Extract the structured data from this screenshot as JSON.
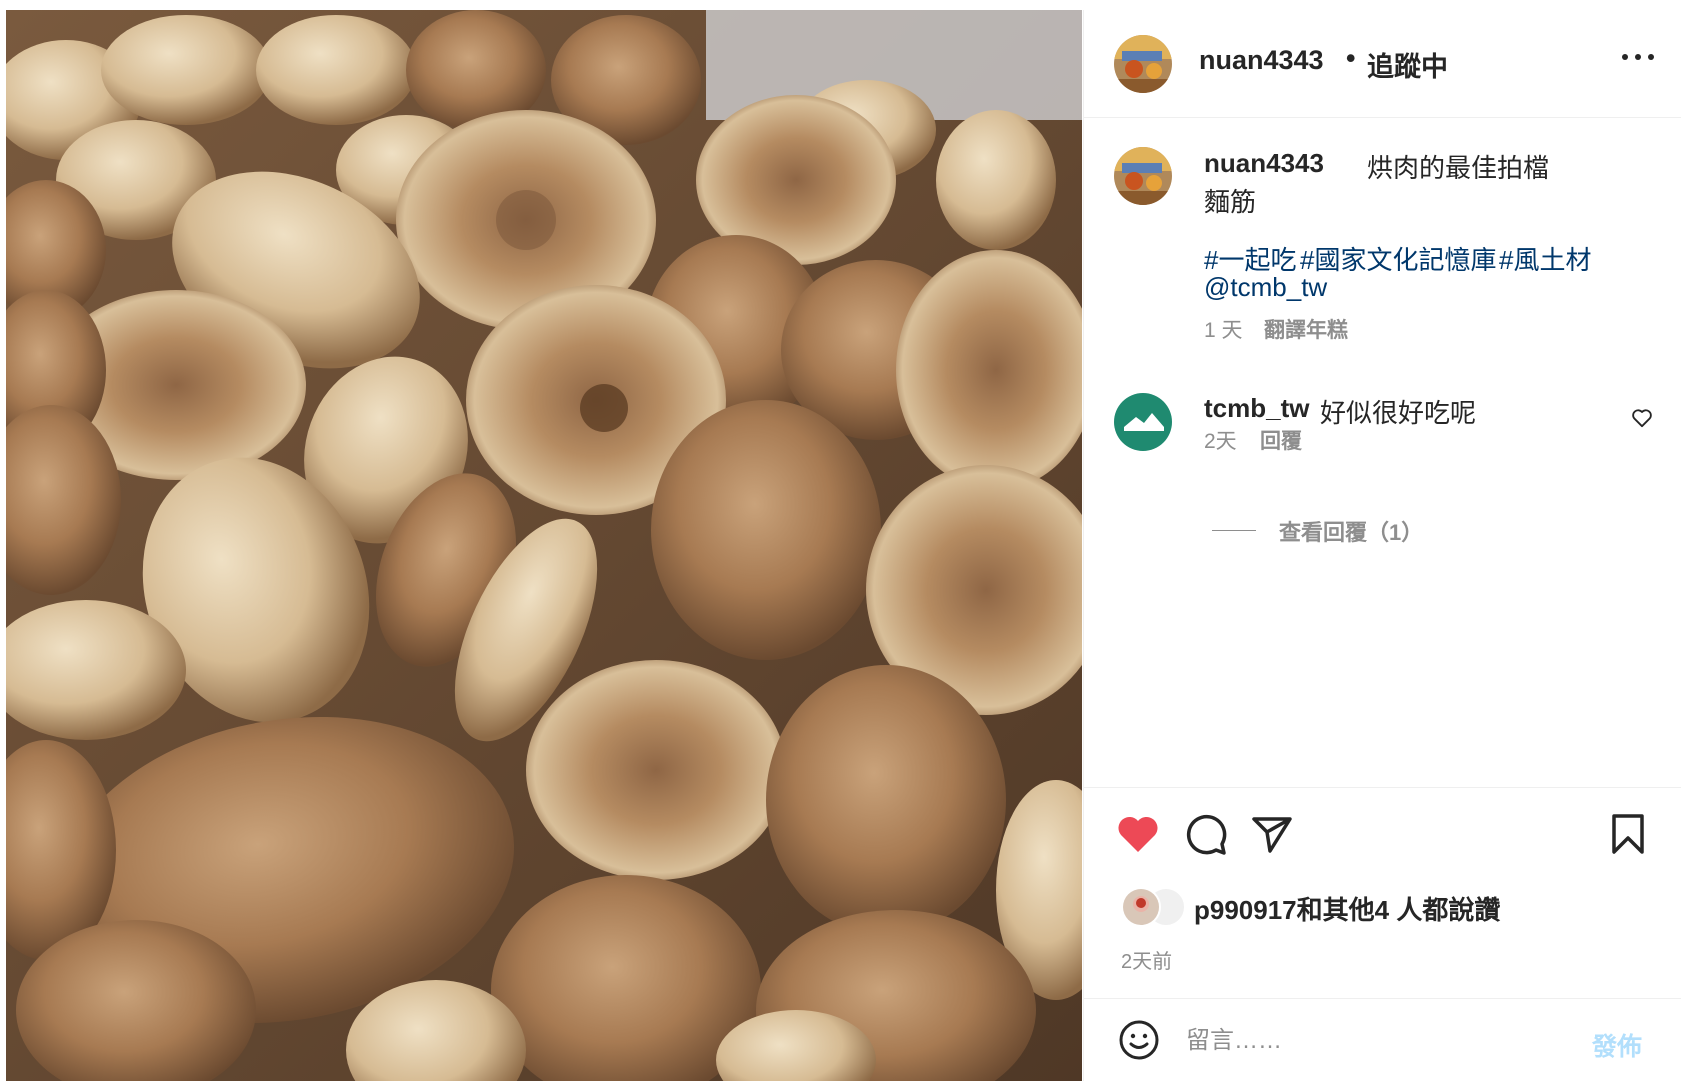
{
  "post": {
    "username": "nuan4343",
    "separator": "•",
    "follow_status": "追蹤中",
    "more_icon": "more-horizontal-icon"
  },
  "caption": {
    "username": "nuan4343",
    "line1": "烘肉的最佳拍檔",
    "line2": "麵筋",
    "hashtags": [
      "#一起吃",
      "#國家文化記憶庫",
      "#風土材"
    ],
    "mention": "@tcmb_tw",
    "age": "1 天",
    "translate": "翻譯年糕"
  },
  "comment": {
    "username": "tcmb_tw",
    "text": "好似很好吃呢",
    "age": "2天",
    "reply": "回覆",
    "view_replies": "查看回覆（1）"
  },
  "actions": {
    "like_color": "#ed4956",
    "liked": true
  },
  "likes": {
    "text": "p990917和其他4 人都說讚"
  },
  "timestamp": "2天前",
  "comment_box": {
    "placeholder": "留言……",
    "post_label": "發佈"
  }
}
